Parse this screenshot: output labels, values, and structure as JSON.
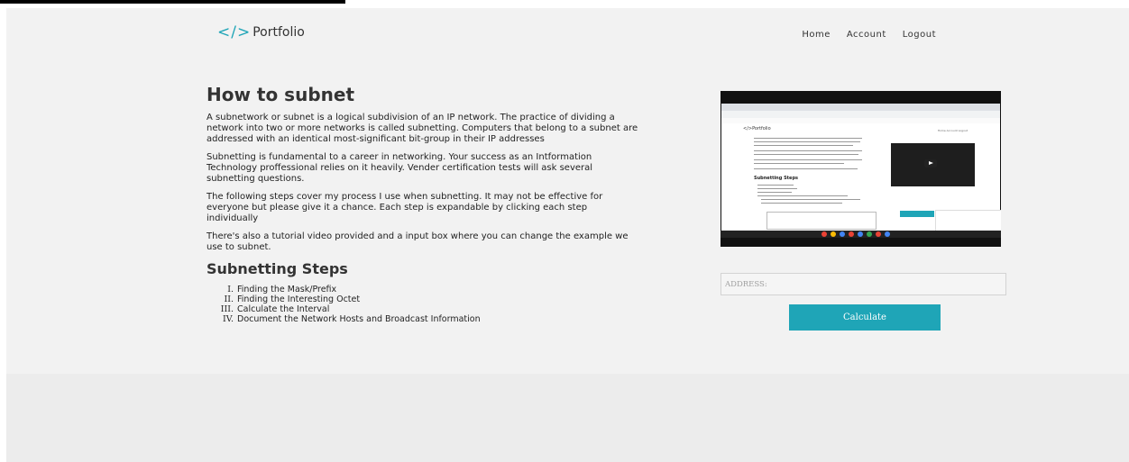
{
  "brand": {
    "logo_mark": "</>",
    "logo_text": "Portfolio"
  },
  "nav": {
    "items": [
      "Home",
      "Account",
      "Logout"
    ]
  },
  "main": {
    "title": "How to subnet",
    "paragraphs": [
      "A subnetwork or subnet is a logical subdivision of an IP network. The practice of dividing a network into two or more networks is called subnetting. Computers that belong to a subnet are addressed with an identical most-significant bit-group in their IP addresses",
      "Subnetting is fundamental to a career in networking. Your success as an Intformation Technology proffessional relies on it heavily. Vender certification tests will ask several subnetting questions.",
      "The following steps cover my process I use when subnetting. It may not be effective for everyone but please give it a chance. Each step is expandable by clicking each step individually",
      "There's also a tutorial video provided and a input box where you can change the example we use to subnet."
    ],
    "steps_title": "Subnetting Steps",
    "steps": [
      {
        "num": "I.",
        "label": "Finding the Mask/Prefix"
      },
      {
        "num": "II.",
        "label": "Finding the Interesting Octet"
      },
      {
        "num": "III.",
        "label": "Calculate the Interval"
      },
      {
        "num": "IV.",
        "label": "Document the Network Hosts and Broadcast Information"
      }
    ]
  },
  "video": {
    "inner_logo": "</>Portfolio",
    "inner_nav": "Home   Account   Logout",
    "inner_title": "Subnetting Steps"
  },
  "form": {
    "address_placeholder": "ADDRESS:",
    "calculate_label": "Calculate"
  },
  "colors": {
    "accent": "#1fa5b7",
    "background": "#f2f2f2"
  }
}
